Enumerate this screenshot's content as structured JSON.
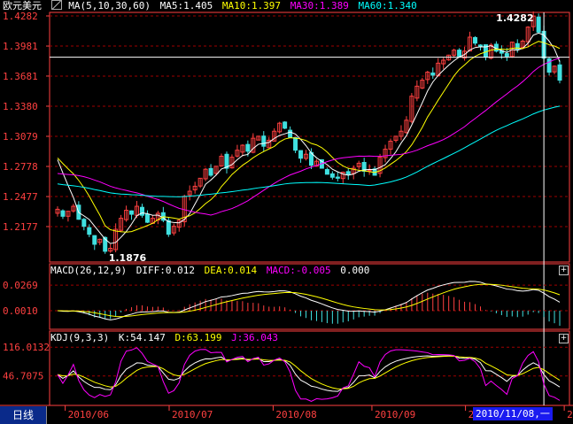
{
  "header": {
    "symbol": "欧元美元",
    "ma_icon": "chart-icon",
    "ma_label": "MA(5,10,30,60)",
    "ma5": "MA5:1.405",
    "ma10": "MA10:1.397",
    "ma30": "MA30:1.389",
    "ma60": "MA60:1.340"
  },
  "macd_header": {
    "label": "MACD(26,12,9)",
    "diff": "DIFF:0.012",
    "dea": "DEA:0.014",
    "macd": "MACD:-0.005",
    "value": "0.000"
  },
  "kdj_header": {
    "label": "KDJ(9,3,3)",
    "k": "K:54.147",
    "d": "D:63.199",
    "j": "J:36.043"
  },
  "footer": {
    "period": "日线",
    "cursor_date": "2010/11/08,一"
  },
  "colors": {
    "up": "#ff4040",
    "down": "#40e0e0",
    "ma5": "#ffffff",
    "ma10": "#ffff00",
    "ma30": "#ff00ff",
    "ma60": "#00ffff",
    "grid": "#a00000",
    "axis": "#ff4040"
  },
  "chart_data": [
    {
      "type": "candlestick",
      "y_ticks": [
        "1.4282",
        "1.3981",
        "1.3681",
        "1.3380",
        "1.3079",
        "1.2778",
        "1.2477",
        "1.2177"
      ],
      "ylim": [
        1.1876,
        1.4282
      ],
      "annotations": [
        {
          "text": "1.4282",
          "value": 1.4282
        },
        {
          "text": "1.1876",
          "value": 1.1876
        }
      ],
      "x_ticks": [
        "2010/06",
        "2010/07",
        "2010/08",
        "2010/09",
        "2010/10",
        "2010/11"
      ],
      "closes": [
        1.235,
        1.228,
        1.233,
        1.238,
        1.225,
        1.218,
        1.21,
        1.2,
        1.205,
        1.193,
        1.196,
        1.215,
        1.226,
        1.234,
        1.23,
        1.238,
        1.229,
        1.222,
        1.226,
        1.231,
        1.224,
        1.21,
        1.218,
        1.224,
        1.248,
        1.253,
        1.258,
        1.266,
        1.275,
        1.269,
        1.278,
        1.288,
        1.276,
        1.287,
        1.294,
        1.299,
        1.293,
        1.306,
        1.308,
        1.298,
        1.304,
        1.313,
        1.321,
        1.316,
        1.307,
        1.294,
        1.286,
        1.29,
        1.279,
        1.283,
        1.276,
        1.27,
        1.267,
        1.266,
        1.272,
        1.27,
        1.276,
        1.281,
        1.273,
        1.274,
        1.269,
        1.287,
        1.295,
        1.303,
        1.308,
        1.313,
        1.324,
        1.348,
        1.358,
        1.364,
        1.372,
        1.369,
        1.381,
        1.384,
        1.389,
        1.394,
        1.388,
        1.393,
        1.407,
        1.401,
        1.398,
        1.387,
        1.399,
        1.393,
        1.391,
        1.388,
        1.402,
        1.395,
        1.403,
        1.417,
        1.428,
        1.412,
        1.386,
        1.372,
        1.378,
        1.364
      ],
      "horizontal_line": 1.387,
      "series_labels": [
        "MA5",
        "MA10",
        "MA30",
        "MA60"
      ]
    },
    {
      "type": "macd",
      "y_ticks": [
        "0.0269",
        "0.0010"
      ],
      "ylim": [
        -0.016,
        0.036
      ]
    },
    {
      "type": "kdj",
      "y_ticks": [
        "116.0132",
        "46.7075"
      ],
      "ylim": [
        -20,
        125
      ]
    }
  ]
}
